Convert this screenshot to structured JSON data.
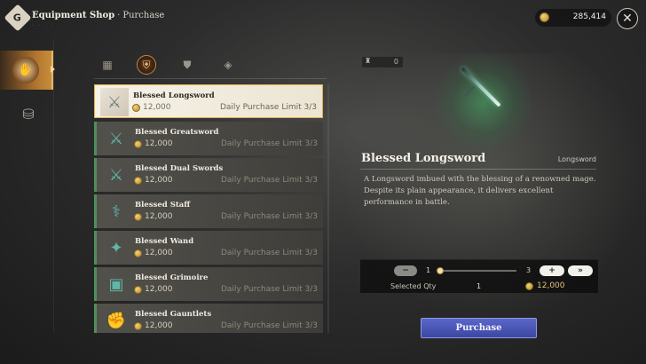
{
  "header": {
    "logo_letter": "G",
    "title": "Equipment Shop",
    "separator": "·",
    "subtitle": "Purchase",
    "subtitle_small": "· · · · ·"
  },
  "currency": {
    "icon": "gold-coin-icon",
    "amount": "285,414"
  },
  "nav": {
    "items": [
      {
        "name": "equipment",
        "icon": "weapon-hand-icon",
        "active": true
      },
      {
        "name": "materials",
        "icon": "coin-stack-icon",
        "active": false
      }
    ]
  },
  "tabs": [
    {
      "icon": "grid-icon",
      "active": false
    },
    {
      "icon": "shield-icon",
      "active": true
    },
    {
      "icon": "armor-icon",
      "active": false
    },
    {
      "icon": "accessory-icon",
      "active": false
    }
  ],
  "items": [
    {
      "name": "Blessed Longsword",
      "price": "12,000",
      "limit": "Daily Purchase Limit 3/3",
      "icon": "longsword-icon",
      "selected": true
    },
    {
      "name": "Blessed Greatsword",
      "price": "12,000",
      "limit": "Daily Purchase Limit 3/3",
      "icon": "greatsword-icon",
      "selected": false
    },
    {
      "name": "Blessed Dual Swords",
      "price": "12,000",
      "limit": "Daily Purchase Limit 3/3",
      "icon": "dual-swords-icon",
      "selected": false
    },
    {
      "name": "Blessed Staff",
      "price": "12,000",
      "limit": "Daily Purchase Limit 3/3",
      "icon": "staff-icon",
      "selected": false
    },
    {
      "name": "Blessed Wand",
      "price": "12,000",
      "limit": "Daily Purchase Limit 3/3",
      "icon": "wand-icon",
      "selected": false
    },
    {
      "name": "Blessed Grimoire",
      "price": "12,000",
      "limit": "Daily Purchase Limit 3/3",
      "icon": "grimoire-icon",
      "selected": false
    },
    {
      "name": "Blessed Gauntlets",
      "price": "12,000",
      "limit": "Daily Purchase Limit 3/3",
      "icon": "gauntlets-icon",
      "selected": false
    }
  ],
  "detail": {
    "owned_count": "0",
    "name": "Blessed Longsword",
    "type": "Longsword",
    "description": "A Longsword imbued with the blessing of a renowned mage. Despite its plain appearance, it delivers excellent performance in battle."
  },
  "quantity": {
    "minus_label": "−",
    "plus_label": "+",
    "max_label": "»",
    "min": "1",
    "max": "3",
    "slider_fraction": 0,
    "selected_label": "Selected Qty",
    "selected_value": "1",
    "total_price": "12,000"
  },
  "purchase_label": "Purchase"
}
